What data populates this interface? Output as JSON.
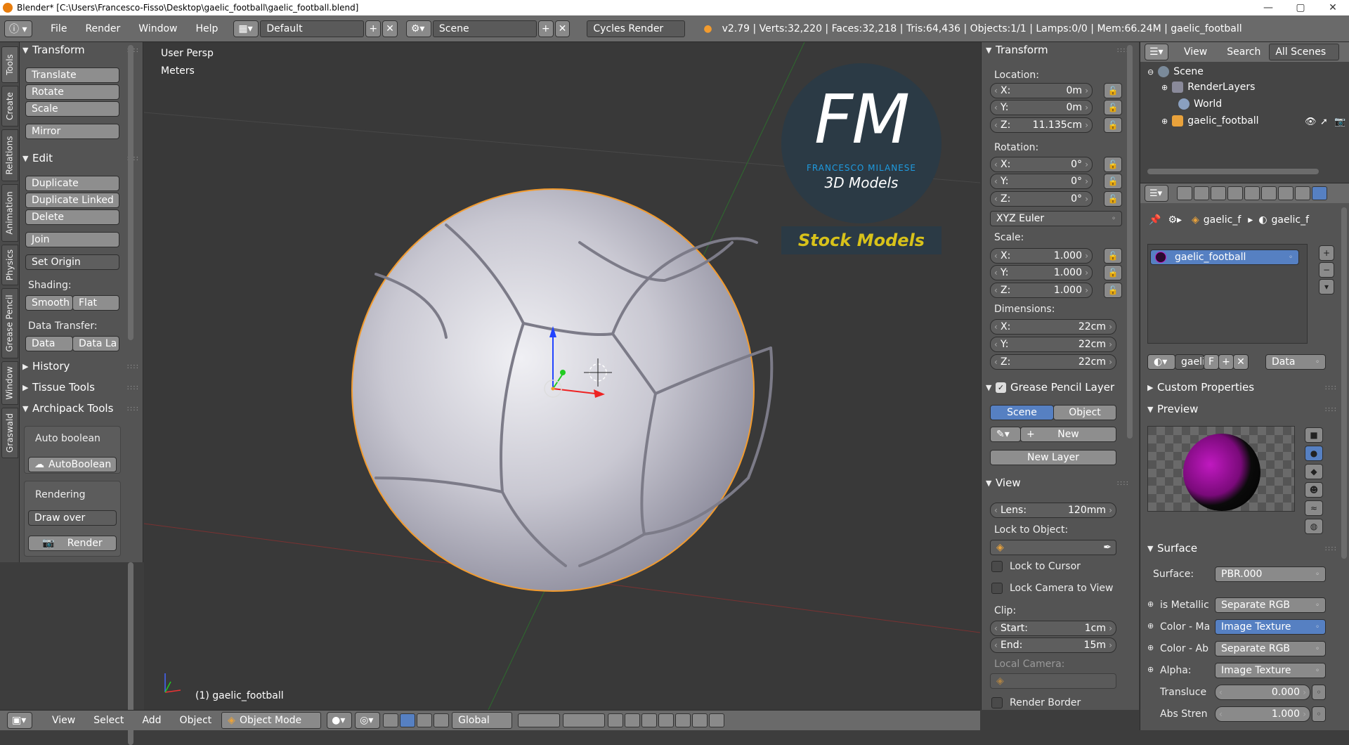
{
  "titlebar": {
    "title": "Blender* [C:\\Users\\Francesco-Fisso\\Desktop\\gaelic_football\\gaelic_football.blend]",
    "minimize": "—",
    "maximize": "▢",
    "close": "✕"
  },
  "topbar": {
    "menus": [
      "File",
      "Render",
      "Window",
      "Help"
    ],
    "screen_layout": "Default",
    "scene": "Scene",
    "engine": "Cycles Render",
    "stats": "v2.79 | Verts:32,220 | Faces:32,218 | Tris:64,436 | Objects:1/1 | Lamps:0/0 | Mem:66.24M | gaelic_football"
  },
  "left_tabs": [
    "Tools",
    "Create",
    "Relations",
    "Animation",
    "Physics",
    "Grease Pencil",
    "Window",
    "Graswald"
  ],
  "toolshelf": {
    "transform_title": "Transform",
    "transform_buttons": [
      "Translate",
      "Rotate",
      "Scale",
      "Mirror"
    ],
    "edit_title": "Edit",
    "edit_buttons": [
      "Duplicate",
      "Duplicate Linked",
      "Delete",
      "Join"
    ],
    "set_origin": "Set Origin",
    "shading_label": "Shading:",
    "smooth": "Smooth",
    "flat": "Flat",
    "data_transfer_label": "Data Transfer:",
    "data": "Data",
    "data_la": "Data La",
    "history": "History",
    "tissue_tools": "Tissue Tools",
    "archipack_tools": "Archipack Tools",
    "auto_boolean_label": "Auto boolean",
    "auto_boolean_btn": "AutoBoolean",
    "rendering_label": "Rendering",
    "draw_over": "Draw over",
    "render_btn": "Render"
  },
  "viewport": {
    "view_name": "User Persp",
    "units": "Meters",
    "object_label": "(1) gaelic_football",
    "logo_letters": "FM",
    "logo_name": "FRANCESCO MILANESE",
    "logo_sub": "3D Models",
    "stock_label": "Stock Models"
  },
  "npanel": {
    "transform_title": "Transform",
    "location_label": "Location:",
    "location": [
      {
        "k": "X:",
        "v": "0m"
      },
      {
        "k": "Y:",
        "v": "0m"
      },
      {
        "k": "Z:",
        "v": "11.135cm"
      }
    ],
    "rotation_label": "Rotation:",
    "rotation": [
      {
        "k": "X:",
        "v": "0°"
      },
      {
        "k": "Y:",
        "v": "0°"
      },
      {
        "k": "Z:",
        "v": "0°"
      }
    ],
    "rotation_mode": "XYZ Euler",
    "scale_label": "Scale:",
    "scale": [
      {
        "k": "X:",
        "v": "1.000"
      },
      {
        "k": "Y:",
        "v": "1.000"
      },
      {
        "k": "Z:",
        "v": "1.000"
      }
    ],
    "dimensions_label": "Dimensions:",
    "dimensions": [
      {
        "k": "X:",
        "v": "22cm"
      },
      {
        "k": "Y:",
        "v": "22cm"
      },
      {
        "k": "Z:",
        "v": "22cm"
      }
    ],
    "grease_pencil_title": "Grease Pencil Layer",
    "gp_scene": "Scene",
    "gp_object": "Object",
    "gp_new": "New",
    "gp_new_layer": "New Layer",
    "view_title": "View",
    "lens_k": "Lens:",
    "lens_v": "120mm",
    "lock_to_object": "Lock to Object:",
    "lock_to_cursor": "Lock to Cursor",
    "lock_camera": "Lock Camera to View",
    "clip_label": "Clip:",
    "clip_start_k": "Start:",
    "clip_start_v": "1cm",
    "clip_end_k": "End:",
    "clip_end_v": "15m",
    "local_camera": "Local Camera:",
    "render_border": "Render Border"
  },
  "outliner": {
    "view": "View",
    "search": "Search",
    "all_scenes": "All Scenes",
    "scene": "Scene",
    "render_layers": "RenderLayers",
    "world": "World",
    "object": "gaelic_football"
  },
  "properties": {
    "crumb1": "gaelic_f",
    "crumb2": "gaelic_f",
    "material_slot": "gaelic_football",
    "mat_name": "gaelic",
    "mat_f": "F",
    "mat_link": "Data",
    "custom_props": "Custom Properties",
    "preview": "Preview",
    "surface_title": "Surface",
    "surface_label": "Surface:",
    "surface_value": "PBR.000",
    "inputs": [
      {
        "k": "is Metallic",
        "v": "Separate RGB",
        "blue": false
      },
      {
        "k": "Color - Ma",
        "v": "Image Texture",
        "blue": true
      },
      {
        "k": "Color - Ab",
        "v": "Separate RGB",
        "blue": false
      },
      {
        "k": "Alpha:",
        "v": "Image Texture",
        "blue": false
      }
    ],
    "translucency_k": "Transluce",
    "translucency_v": "0.000",
    "abs_strength_k": "Abs Stren",
    "abs_strength_v": "1.000"
  },
  "bottombar": {
    "view": "View",
    "select": "Select",
    "add": "Add",
    "object": "Object",
    "mode": "Object Mode",
    "orientation": "Global"
  },
  "colors": {
    "accent_blue": "#5680c2",
    "logo_blue": "#1e9be0",
    "stock_yellow": "#d8c21a",
    "selection_orange": "#f29b2e"
  }
}
